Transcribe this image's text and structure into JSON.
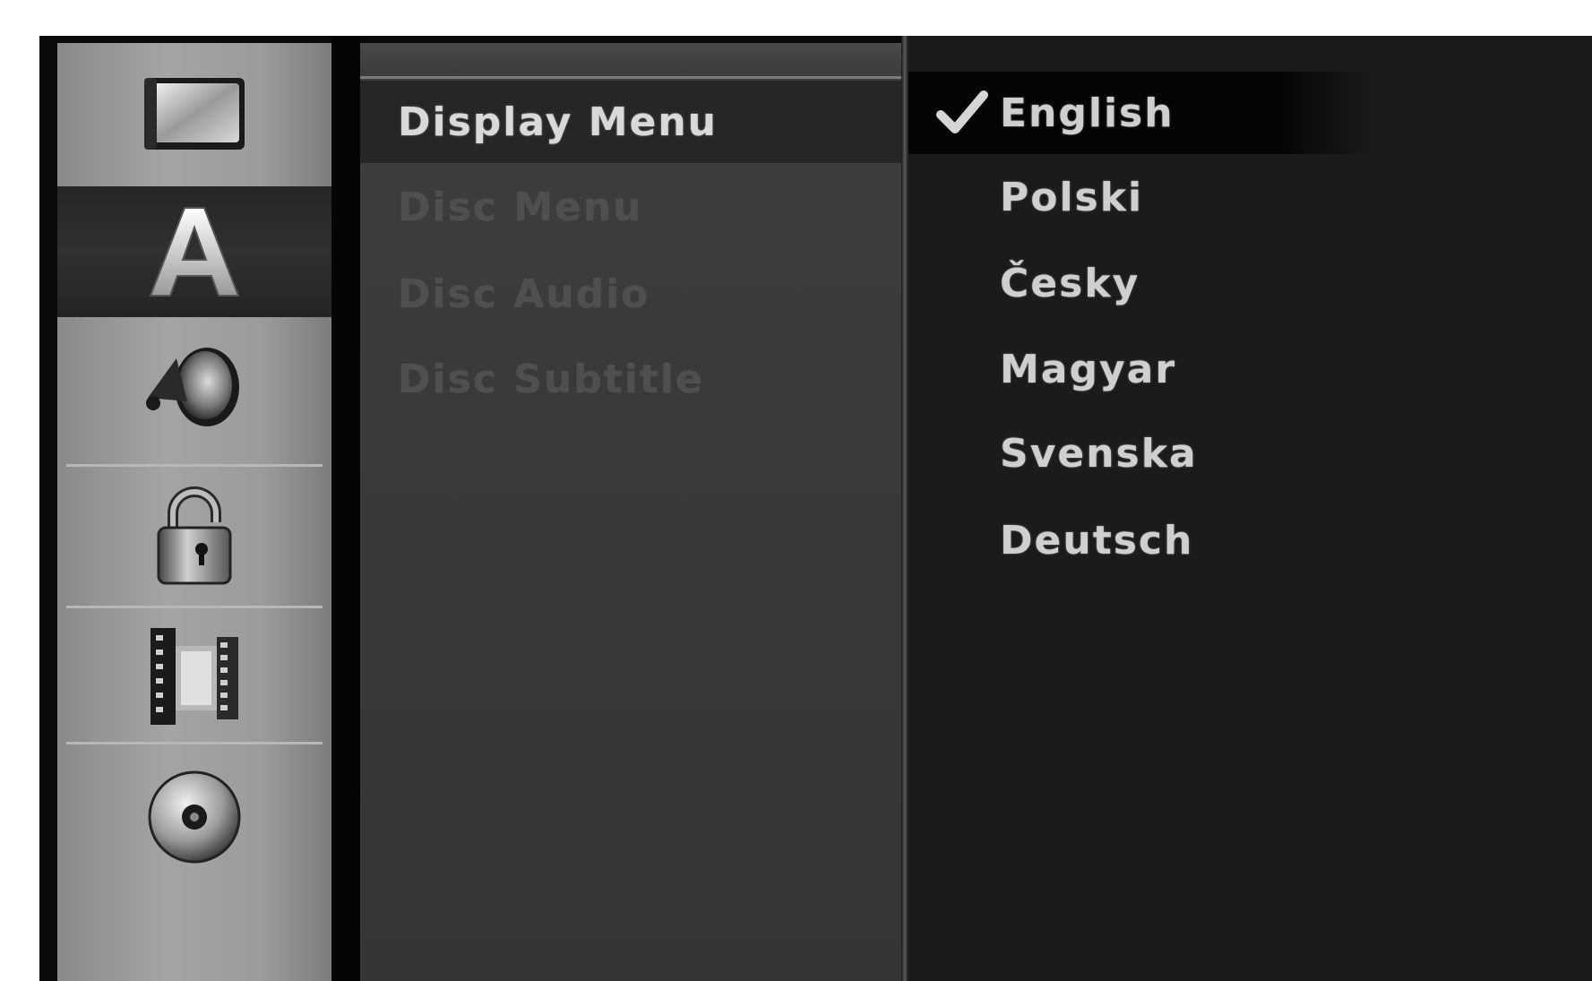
{
  "sidebar": {
    "items": [
      {
        "icon": "tv-screen-icon",
        "active": false
      },
      {
        "icon": "language-letter-a-icon",
        "active": true,
        "glyph": "A"
      },
      {
        "icon": "speaker-icon",
        "active": false
      },
      {
        "icon": "padlock-icon",
        "active": false
      },
      {
        "icon": "film-reel-icon",
        "active": false
      },
      {
        "icon": "disc-icon",
        "active": false
      }
    ]
  },
  "options": {
    "items": [
      {
        "label": "Display Menu",
        "selected": true
      },
      {
        "label": "Disc Menu",
        "selected": false
      },
      {
        "label": "Disc Audio",
        "selected": false
      },
      {
        "label": "Disc Subtitle",
        "selected": false
      }
    ]
  },
  "values": {
    "items": [
      {
        "label": "English",
        "checked": true
      },
      {
        "label": "Polski",
        "checked": false
      },
      {
        "label": "Česky",
        "checked": false
      },
      {
        "label": "Magyar",
        "checked": false
      },
      {
        "label": "Svenska",
        "checked": false
      },
      {
        "label": "Deutsch",
        "checked": false
      }
    ]
  }
}
